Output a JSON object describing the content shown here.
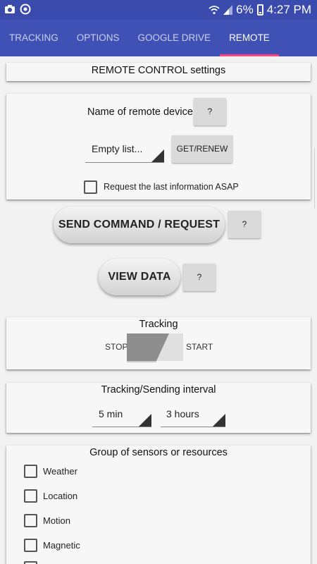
{
  "status_bar": {
    "battery_percent": "6%",
    "time": "4:27 PM"
  },
  "tabs": [
    {
      "label": "TRACKING"
    },
    {
      "label": "OPTIONS"
    },
    {
      "label": "GOOGLE DRIVE"
    },
    {
      "label": "REMOTE"
    }
  ],
  "header": {
    "title": "REMOTE CONTROL settings"
  },
  "remote_device": {
    "label": "Name of remote device",
    "help_label": "?",
    "device_spinner_value": "Empty list...",
    "get_renew_label": "GET/RENEW",
    "request_last_info_label": "Request the last information ASAP"
  },
  "send_command": {
    "label": "SEND COMMAND / REQUEST",
    "help_label": "?"
  },
  "view_data": {
    "label": "VIEW DATA",
    "help_label": "?"
  },
  "tracking": {
    "title": "Tracking",
    "stop_label": "STOP",
    "start_label": "START"
  },
  "interval": {
    "title": "Tracking/Sending interval",
    "tracking_value": "5 min",
    "sending_value": "3 hours"
  },
  "sensors": {
    "title": "Group of sensors or resources",
    "items": [
      {
        "label": "Weather"
      },
      {
        "label": "Location"
      },
      {
        "label": "Motion"
      },
      {
        "label": "Magnetic"
      }
    ]
  }
}
